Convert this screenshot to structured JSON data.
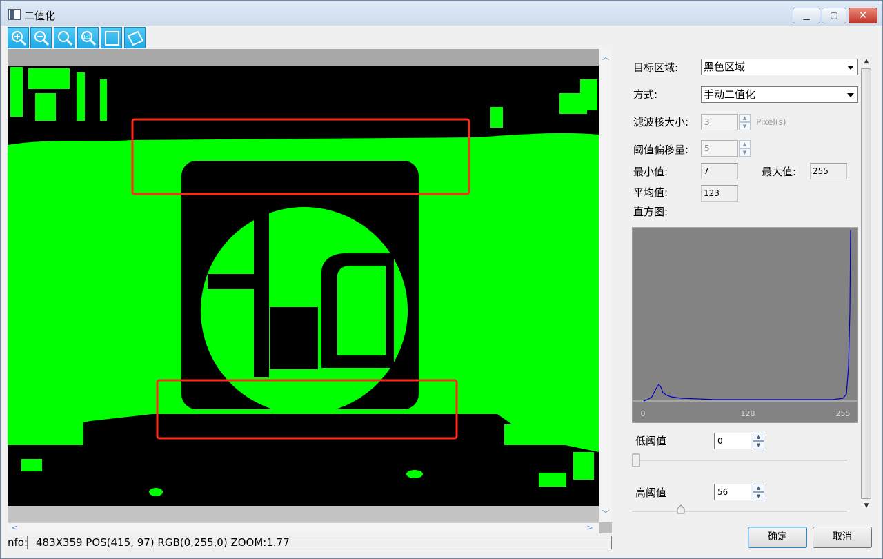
{
  "window": {
    "title": "二值化",
    "controls": {
      "minimize": "▁",
      "maximize": "▢",
      "close": "✕"
    }
  },
  "toolbar": {
    "tools": [
      "zoom-in-icon",
      "zoom-out-icon",
      "zoom-fit-icon",
      "zoom-actual-icon",
      "rectangle-roi-icon",
      "rotated-rectangle-roi-icon"
    ]
  },
  "viewer": {
    "image_background": "#000000",
    "foreground_color": "#00ff00",
    "roi_color": "#ff2a1a",
    "info_label": "nfo:",
    "info_text": "483X359  POS(415,  97)  RGB(0,255,0)  ZOOM:1.77"
  },
  "settings": {
    "target_region_label": "目标区域:",
    "target_region_value": "黑色区域",
    "method_label": "方式:",
    "method_value": "手动二值化",
    "filter_kernel_label": "滤波核大小:",
    "filter_kernel_value": "3",
    "filter_kernel_unit": "Pixel(s)",
    "threshold_offset_label": "阈值偏移量:",
    "threshold_offset_value": "5",
    "min_label": "最小值:",
    "min_value": "7",
    "max_label": "最大值:",
    "max_value": "255",
    "avg_label": "平均值:",
    "avg_value": "123",
    "histogram_label": "直方图:"
  },
  "histogram": {
    "background": "#838383",
    "line_color": "#0000cc",
    "tick_labels": [
      "0",
      "128",
      "255"
    ]
  },
  "thresholds": {
    "low_label": "低阈值",
    "low_value": "0",
    "high_label": "高阈值",
    "high_value": "56"
  },
  "buttons": {
    "ok": "确定",
    "cancel": "取消"
  }
}
